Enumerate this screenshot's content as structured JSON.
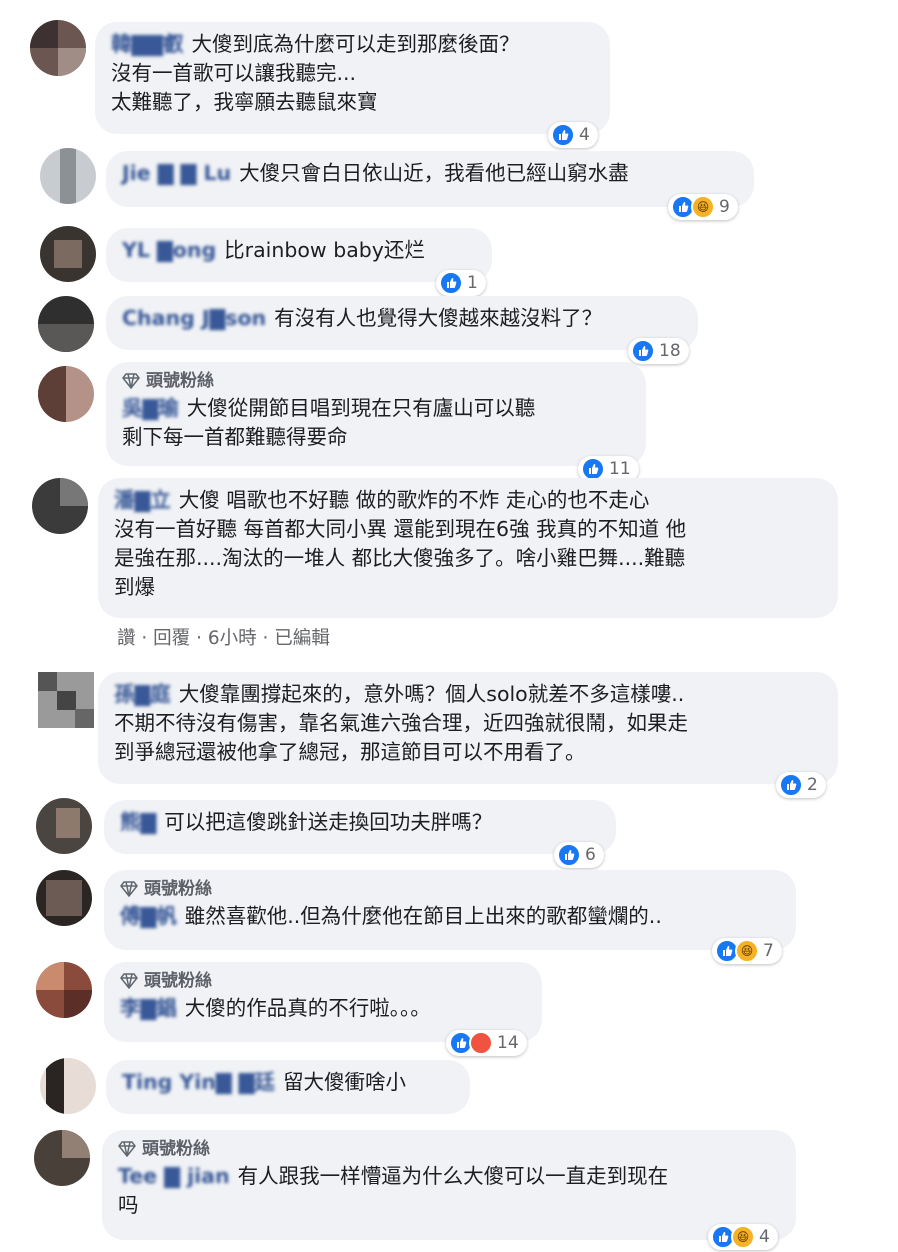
{
  "badge_label": "頭號粉絲",
  "comments": [
    {
      "name": "韓▇▇叡",
      "text": "大傻到底為什麼可以走到那麼後面？\n沒有一首歌可以讓我聽完...\n太難聽了，我寧願去聽鼠來寶",
      "reaction_count": "4",
      "reactions": [
        "like-icon"
      ]
    },
    {
      "name": "Jie ▇ ▇ Lu",
      "text": "大傻只會白日依山近，我看他已經山窮水盡",
      "reaction_count": "9",
      "reactions": [
        "like-icon",
        "haha-icon"
      ]
    },
    {
      "name": "YL ▇ong",
      "text": "比rainbow baby还烂",
      "reaction_count": "1",
      "reactions": [
        "like-icon"
      ]
    },
    {
      "name": "Chang J▇son",
      "text": "有沒有人也覺得大傻越來越沒料了？",
      "reaction_count": "18",
      "reactions": [
        "like-icon"
      ]
    },
    {
      "name": "吳▇瑜",
      "text": "大傻從開節目唱到現在只有廬山可以聽\n剩下每一首都難聽得要命",
      "reaction_count": "11",
      "reactions": [
        "like-icon"
      ],
      "top_fan": true
    },
    {
      "name": "潘▇立",
      "text": "大傻 唱歌也不好聽 做的歌炸的不炸 走心的也不走心\n沒有一首好聽 每首都大同小異 還能到現在6強 我真的不知道 他\n是強在那....淘汰的一堆人 都比大傻強多了。啥小雞巴舞....難聽\n到爆",
      "actions": {
        "like": "讚",
        "reply": "回覆",
        "time": "6小時",
        "edited": "已編輯"
      }
    },
    {
      "name": "孫▇庭",
      "text": "大傻靠團撐起來的，意外嗎？個人solo就差不多這樣嘍..\n不期不待沒有傷害，靠名氣進六強合理，近四強就很鬧，如果走\n到爭總冠還被他拿了總冠，那這節目可以不用看了。",
      "reaction_count": "2",
      "reactions": [
        "like-icon"
      ]
    },
    {
      "name": "熊▇",
      "text": "可以把這傻跳針送走換回功夫胖嗎？",
      "reaction_count": "6",
      "reactions": [
        "like-icon"
      ]
    },
    {
      "name": "傅▇帆",
      "text": "雖然喜歡他..但為什麼他在節目上出來的歌都蠻爛的..",
      "reaction_count": "7",
      "reactions": [
        "like-icon",
        "haha-icon"
      ],
      "top_fan": true
    },
    {
      "name": "李▇錩",
      "text": "大傻的作品真的不行啦。。。",
      "reaction_count": "14",
      "reactions": [
        "like-icon",
        "love-icon"
      ],
      "top_fan": true
    },
    {
      "name": "Ting Yin▇ ▇廷",
      "text": "留大傻衝啥小"
    },
    {
      "name": "Tee ▇ jian",
      "text": "有人跟我一样懵逼为什么大傻可以一直走到现在\n吗",
      "reaction_count": "4",
      "reactions": [
        "like-icon",
        "haha-icon"
      ],
      "top_fan": true
    }
  ]
}
